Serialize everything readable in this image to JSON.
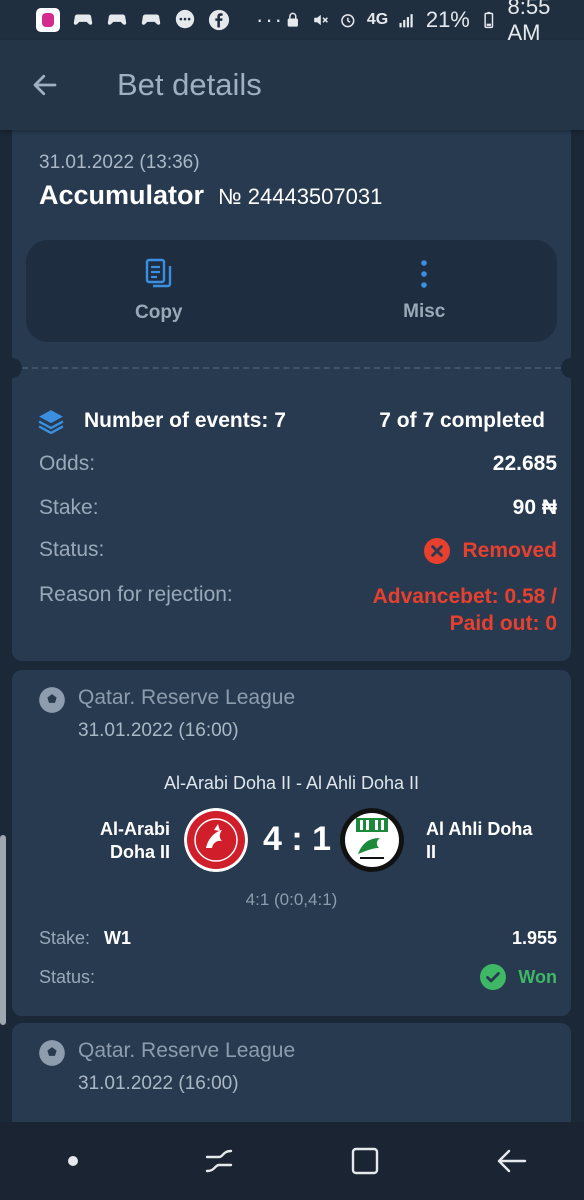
{
  "status_bar": {
    "signal_text": "4G",
    "battery": "21%",
    "time": "8:55 AM",
    "overflow": "···"
  },
  "header": {
    "title": "Bet details"
  },
  "bet": {
    "date": "31.01.2022 (13:36)",
    "type": "Accumulator",
    "number": "№ 24443507031",
    "actions": [
      {
        "label": "Copy",
        "icon": "copy-icon"
      },
      {
        "label": "Misc",
        "icon": "more-vertical-icon"
      }
    ],
    "events_label": "Number of events: 7",
    "events_completed": "7 of 7 completed",
    "odds_label": "Odds:",
    "odds_value": "22.685",
    "stake_label": "Stake:",
    "stake_value": "90 ₦",
    "status_label": "Status:",
    "status_value": "Removed",
    "reason_label": "Reason for rejection:",
    "reason_line1": "Advancebet: 0.58 /",
    "reason_line2": "Paid out: 0"
  },
  "events": [
    {
      "league": "Qatar. Reserve League",
      "date": "31.01.2022 (16:00)",
      "match": "Al-Arabi Doha II - Al Ahli Doha II",
      "home_line1": "Al-Arabi",
      "home_line2": "Doha II",
      "away_line1": "Al Ahli Doha",
      "away_line2": "II",
      "score": "4 : 1",
      "score_detail": "4:1 (0:0,4:1)",
      "stake_label": "Stake:",
      "pick": "W1",
      "coef": "1.955",
      "status_label": "Status:",
      "status_value": "Won"
    },
    {
      "league": "Qatar. Reserve League",
      "date": "31.01.2022 (16:00)"
    }
  ],
  "colors": {
    "background": "#1b2838",
    "card": "#273a50",
    "accent_blue": "#3b8fe0",
    "removed_red": "#e8402f",
    "won_green": "#3fb865"
  }
}
